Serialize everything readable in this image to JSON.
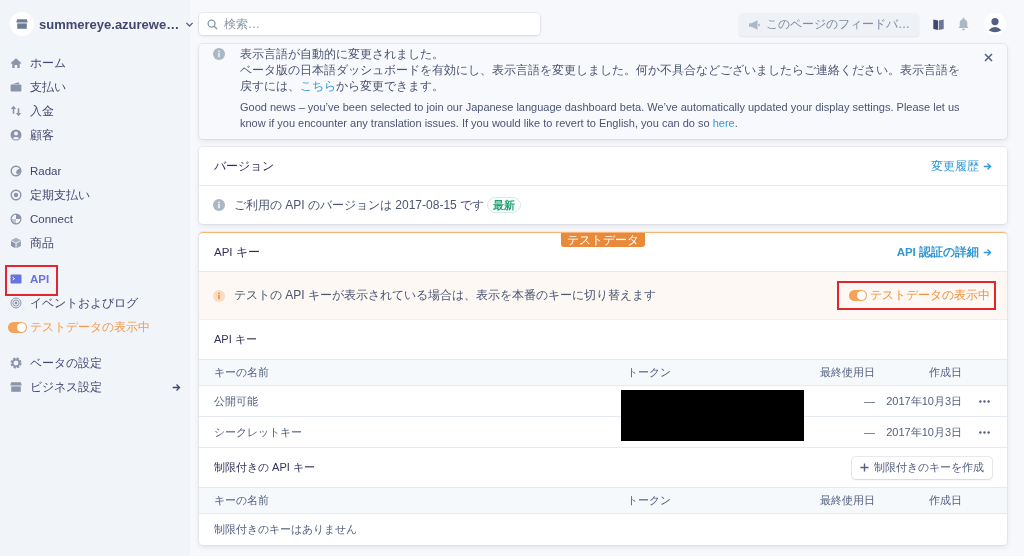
{
  "account": {
    "name": "summereye.azurewe…"
  },
  "sidebar": {
    "groups": [
      {
        "items": [
          {
            "kind": "link",
            "label": "ホーム",
            "selected": false,
            "highlighted": false
          },
          {
            "kind": "link",
            "label": "支払い",
            "selected": false,
            "highlighted": false
          },
          {
            "kind": "link",
            "label": "入金",
            "selected": false,
            "highlighted": false
          },
          {
            "kind": "link",
            "label": "顧客",
            "selected": false,
            "highlighted": false
          }
        ]
      },
      {
        "items": [
          {
            "kind": "link",
            "label": "Radar",
            "selected": false,
            "highlighted": false
          },
          {
            "kind": "link",
            "label": "定期支払い",
            "selected": false,
            "highlighted": false
          },
          {
            "kind": "link",
            "label": "Connect",
            "selected": false,
            "highlighted": false
          },
          {
            "kind": "link",
            "label": "商品",
            "selected": false,
            "highlighted": false
          }
        ]
      },
      {
        "items": [
          {
            "kind": "link",
            "label": "API",
            "selected": true,
            "highlighted": true
          },
          {
            "kind": "link",
            "label": "イベントおよびログ",
            "selected": false,
            "highlighted": false
          },
          {
            "kind": "toggle",
            "label": "テストデータの表示中",
            "on": true,
            "selected": false,
            "highlighted": false
          }
        ]
      },
      {
        "items": [
          {
            "kind": "link",
            "label": "ベータの設定",
            "selected": false,
            "highlighted": false
          },
          {
            "kind": "submenu",
            "label": "ビジネス設定",
            "selected": false,
            "highlighted": false
          }
        ]
      }
    ]
  },
  "topbar": {
    "search": {
      "placeholder": "検索…"
    },
    "feedback": "このページのフィードバ…"
  },
  "notice": {
    "title": "表示言語が自動的に変更されました。",
    "paragraphs": [
      {
        "text": "ベータ版の日本語ダッシュボードを有効にし、表示言語を変更しました。何か不具合などございましたらご連絡ください。表示言語を戻すには、",
        "link": "こちら",
        "after": "から変更できます。"
      },
      {
        "text": "Good news – you’ve been selected to join our Japanese language dashboard beta. We’ve automatically updated your display settings. Please let us know if you encounter any translation issues. If you would like to revert to English, you can do so ",
        "link": "here",
        "after": "."
      }
    ]
  },
  "version": {
    "title": "バージョン",
    "link": "変更履歴",
    "message": "ご利用の API のバージョンは 2017-08-15 です",
    "badge": "最新"
  },
  "api_keys": {
    "badge": "テストデータ",
    "title": "API キー",
    "link": "API 認証の詳細",
    "banner": {
      "text": "テストの API キーが表示されている場合は、表示を本番のキーに切り替えます",
      "toggle": {
        "label": "テストデータの表示中",
        "on": true,
        "highlighted": true
      }
    },
    "standard": {
      "title": "API キー",
      "columns": [
        "キーの名前",
        "トークン",
        "最終使用日",
        "作成日"
      ],
      "rows": [
        {
          "name": "公開可能",
          "last_used": "—",
          "created": "2017年10月3日"
        },
        {
          "name": "シークレットキー",
          "last_used": "—",
          "created": "2017年10月3日"
        }
      ],
      "redacted": true
    },
    "restricted": {
      "title": "制限付きの API キー",
      "button": "制限付きのキーを作成",
      "columns": [
        "キーの名前",
        "トークン",
        "最終使用日",
        "作成日"
      ],
      "empty": "制限付きのキーはありません"
    }
  }
}
